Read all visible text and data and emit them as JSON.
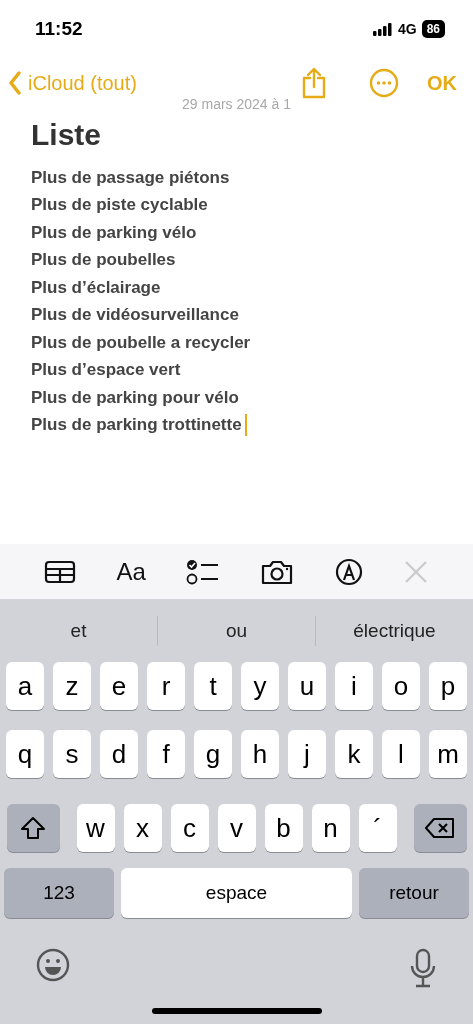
{
  "status_bar": {
    "time": "11:52",
    "network": "4G",
    "battery": "86"
  },
  "nav": {
    "back_label": "iCloud (tout)",
    "done_label": "OK"
  },
  "note": {
    "date": "29 mars 2024 à 1",
    "title": "Liste",
    "lines": [
      {
        "text": "Plus de passage piétons",
        "cursor": false
      },
      {
        "text": "Plus de piste cyclable",
        "cursor": false
      },
      {
        "text": "Plus de parking vélo",
        "cursor": false
      },
      {
        "text": "Plus de poubelles",
        "cursor": false
      },
      {
        "text": "Plus d’éclairage",
        "cursor": false
      },
      {
        "text": "Plus de vidéosurveillance",
        "cursor": false
      },
      {
        "text": "Plus de poubelle a recycler",
        "cursor": false
      },
      {
        "text": "Plus d’espace vert",
        "cursor": false
      },
      {
        "text": "Plus de parking pour vélo",
        "cursor": false
      },
      {
        "text": "Plus de parking trottinette",
        "cursor": true
      }
    ]
  },
  "toolbar": [
    {
      "kind": "table",
      "disabled": false
    },
    {
      "kind": "format",
      "label": "Aa",
      "disabled": false
    },
    {
      "kind": "checklist",
      "disabled": false
    },
    {
      "kind": "camera",
      "disabled": false
    },
    {
      "kind": "markup",
      "disabled": false
    },
    {
      "kind": "close",
      "disabled": true
    }
  ],
  "suggestions": [
    "et",
    "ou",
    "électrique"
  ],
  "keyboard": {
    "rows": [
      {
        "keys": [
          {
            "kind": "letter",
            "label": "a"
          },
          {
            "kind": "letter",
            "label": "z"
          },
          {
            "kind": "letter",
            "label": "e"
          },
          {
            "kind": "letter",
            "label": "r"
          },
          {
            "kind": "letter",
            "label": "t"
          },
          {
            "kind": "letter",
            "label": "y"
          },
          {
            "kind": "letter",
            "label": "u"
          },
          {
            "kind": "letter",
            "label": "i"
          },
          {
            "kind": "letter",
            "label": "o"
          },
          {
            "kind": "letter",
            "label": "p"
          }
        ]
      },
      {
        "keys": [
          {
            "kind": "letter",
            "label": "q"
          },
          {
            "kind": "letter",
            "label": "s"
          },
          {
            "kind": "letter",
            "label": "d"
          },
          {
            "kind": "letter",
            "label": "f"
          },
          {
            "kind": "letter",
            "label": "g"
          },
          {
            "kind": "letter",
            "label": "h"
          },
          {
            "kind": "letter",
            "label": "j"
          },
          {
            "kind": "letter",
            "label": "k"
          },
          {
            "kind": "letter",
            "label": "l"
          },
          {
            "kind": "letter",
            "label": "m"
          }
        ]
      },
      {
        "keys": [
          {
            "kind": "shift"
          },
          {
            "kind": "letter",
            "label": "w"
          },
          {
            "kind": "letter",
            "label": "x"
          },
          {
            "kind": "letter",
            "label": "c"
          },
          {
            "kind": "letter",
            "label": "v"
          },
          {
            "kind": "letter",
            "label": "b"
          },
          {
            "kind": "letter",
            "label": "n"
          },
          {
            "kind": "letter",
            "label": "´"
          },
          {
            "kind": "backspace"
          }
        ]
      },
      {
        "keys": [
          {
            "kind": "mode",
            "label": "123"
          },
          {
            "kind": "space",
            "label": "espace"
          },
          {
            "kind": "return",
            "label": "retour"
          }
        ]
      }
    ]
  }
}
